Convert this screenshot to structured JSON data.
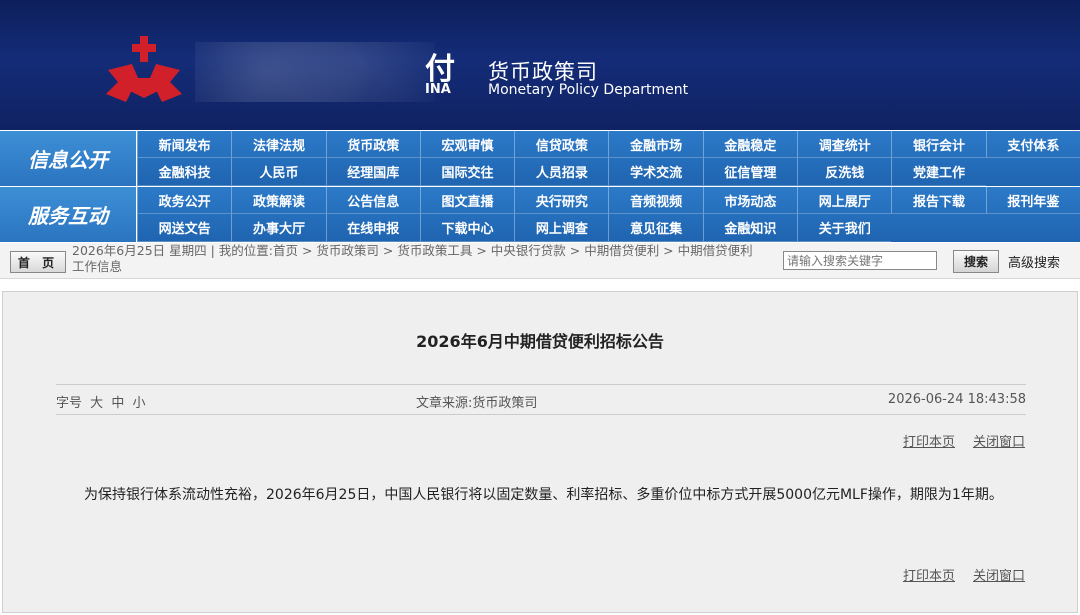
{
  "colors": {
    "banner": "#142c78",
    "nav": "#2c7ac8",
    "navlabel": "#3d8fd6",
    "logo": "#d2202a"
  },
  "banner": {
    "bank_cn_fragment": "付",
    "bank_en_fragment": "INA",
    "dept_cn": "货币政策司",
    "dept_en": "Monetary Policy Department",
    "logo_icon": "pboc-logo-icon"
  },
  "nav": {
    "row1_label": "信息公开",
    "row1_items": [
      "新闻发布",
      "法律法规",
      "货币政策",
      "宏观审慎",
      "信贷政策",
      "金融市场",
      "金融稳定",
      "调查统计",
      "银行会计",
      "支付体系",
      "金融科技",
      "人民币",
      "经理国库",
      "国际交往",
      "人员招录",
      "学术交流",
      "征信管理",
      "反洗钱",
      "党建工作"
    ],
    "row2_label": "服务互动",
    "row2_items": [
      "政务公开",
      "政策解读",
      "公告信息",
      "图文直播",
      "央行研究",
      "音频视频",
      "市场动态",
      "网上展厅",
      "报告下载",
      "报刊年鉴",
      "网送文告",
      "办事大厅",
      "在线申报",
      "下载中心",
      "网上调查",
      "意见征集",
      "金融知识",
      "关于我们"
    ]
  },
  "infobar": {
    "home": "首 页",
    "breadcrumb": "2026年6月25日  星期四  |  我的位置:首页   >  货币政策司   >  货币政策工具   >  中央银行贷款   >  中期借贷便利   >  中期借贷便利工作信息",
    "search_placeholder": "请输入搜索关键字",
    "search_button": "搜索",
    "advanced": "高级搜索"
  },
  "article": {
    "title": "2026年6月中期借贷便利招标公告",
    "fontsize_label": "字号",
    "fontsize_large": "大",
    "fontsize_medium": "中",
    "fontsize_small": "小",
    "source": "文章来源:货币政策司",
    "datetime": "2026-06-24  18:43:58",
    "print": "打印本页",
    "close": "关闭窗口",
    "body": "为保持银行体系流动性充裕，2026年6月25日，中国人民银行将以固定数量、利率招标、多重价位中标方式开展5000亿元MLF操作，期限为1年期。"
  }
}
